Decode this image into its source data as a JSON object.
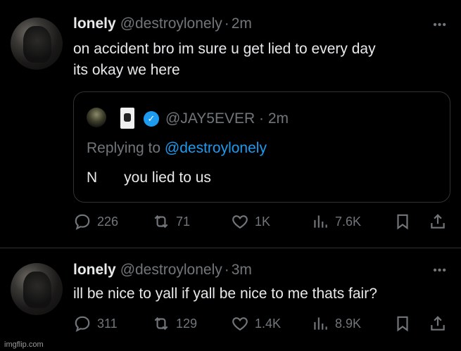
{
  "tweets": [
    {
      "name": "lonely",
      "handle": "@destroylonely",
      "dot": "·",
      "time": "2m",
      "more": "•••",
      "text_lines": [
        "on accident bro im sure u get lied to every day",
        "its okay we here"
      ],
      "quote": {
        "handle": "@JAY5EVER",
        "dot": "·",
        "time": "2m",
        "replying_prefix": "Replying to ",
        "replying_mention": "@destroylonely",
        "body_start": "N",
        "body_rest": "you lied to us",
        "verified_mark": "✓"
      },
      "stats": {
        "replies": "226",
        "retweets": "71",
        "likes": "1K",
        "views": "7.6K"
      }
    },
    {
      "name": "lonely",
      "handle": "@destroylonely",
      "dot": "·",
      "time": "3m",
      "more": "•••",
      "text": "ill be nice to yall if yall be nice to me thats fair?",
      "stats": {
        "replies": "311",
        "retweets": "129",
        "likes": "1.4K",
        "views": "8.9K"
      }
    }
  ],
  "icons": [
    "reply-icon",
    "retweet-icon",
    "like-icon",
    "views-icon",
    "bookmark-icon",
    "share-icon"
  ],
  "colors": {
    "background": "#000000",
    "text": "#e7e9ea",
    "muted": "#71767b",
    "accent": "#1d9bf0",
    "border": "#2f3336"
  },
  "watermark": "imgflip.com"
}
